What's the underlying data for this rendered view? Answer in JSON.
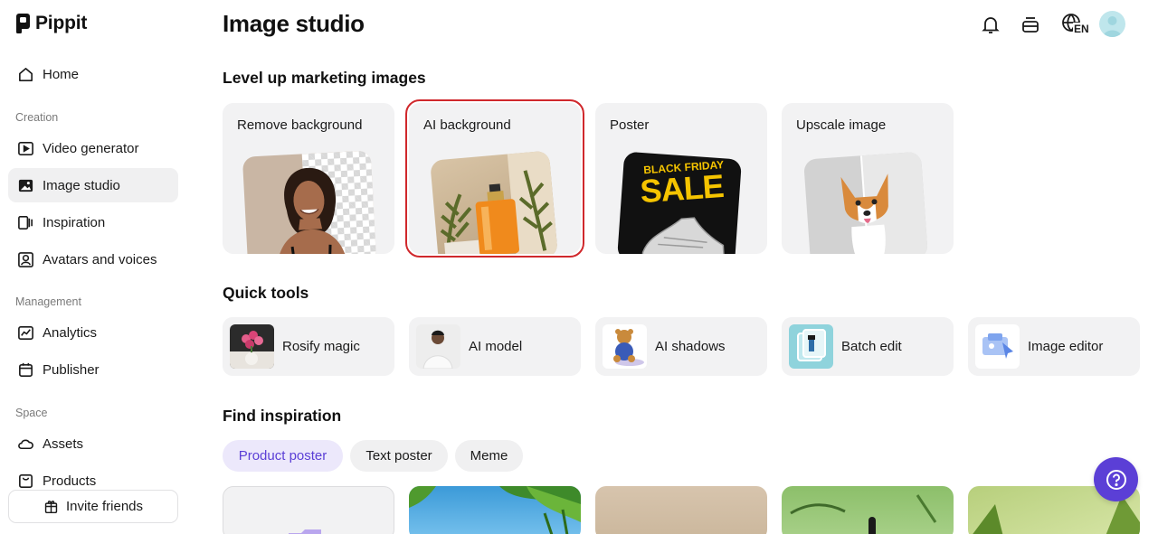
{
  "app": {
    "name": "Pippit"
  },
  "sidebar": {
    "home": "Home",
    "sections": {
      "creation": "Creation",
      "management": "Management",
      "space": "Space"
    },
    "creation_items": [
      "Video generator",
      "Image studio",
      "Inspiration",
      "Avatars and voices"
    ],
    "management_items": [
      "Analytics",
      "Publisher"
    ],
    "space_items": [
      "Assets",
      "Products"
    ],
    "invite": "Invite friends"
  },
  "header": {
    "title": "Image studio",
    "language": "EN"
  },
  "marketing": {
    "heading": "Level up marketing images",
    "cards": [
      "Remove background",
      "AI background",
      "Poster",
      "Upscale image"
    ],
    "poster_text": {
      "line1": "BLACK FRIDAY",
      "line2": "SALE"
    }
  },
  "quick_tools": {
    "heading": "Quick tools",
    "items": [
      "Rosify magic",
      "AI model",
      "AI shadows",
      "Batch edit",
      "Image editor"
    ]
  },
  "inspiration": {
    "heading": "Find inspiration",
    "chips": [
      "Product poster",
      "Text poster",
      "Meme"
    ]
  },
  "colors": {
    "accent": "#5b3fd6",
    "selected_outline": "#d0282c",
    "card_bg": "#f2f2f3"
  }
}
